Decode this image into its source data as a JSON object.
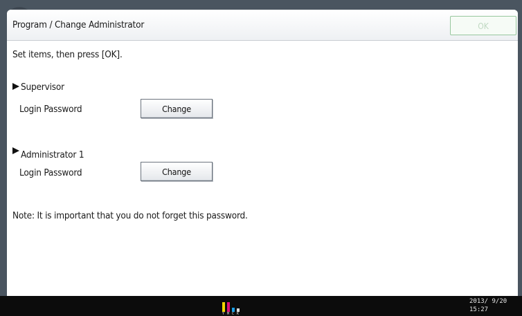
{
  "window": {
    "title": "Program / Change Administrator",
    "ok_label": "OK"
  },
  "instruction": "Set items, then press [OK].",
  "sections": [
    {
      "title": "Supervisor",
      "field_label": "Login Password",
      "button_label": "Change"
    },
    {
      "title": "Administrator 1",
      "field_label": "Login Password",
      "button_label": "Change"
    }
  ],
  "note": "Note: It is important that you do not forget this password.",
  "status_bar": {
    "toner": [
      {
        "label": "Y",
        "color": "#f2d600",
        "level": 1.0
      },
      {
        "label": "M",
        "color": "#e0107a",
        "level": 1.0
      },
      {
        "label": "C",
        "color": "#1aa0e8",
        "level": 0.45
      },
      {
        "label": "K",
        "color": "#d8d8d8",
        "level": 0.35
      }
    ],
    "date": "2013/ 9/20",
    "time": "15:27"
  },
  "colors": {
    "ok_border": "#98c79e",
    "frame": "#4a5560",
    "status_bar": "#0c0c0c"
  }
}
